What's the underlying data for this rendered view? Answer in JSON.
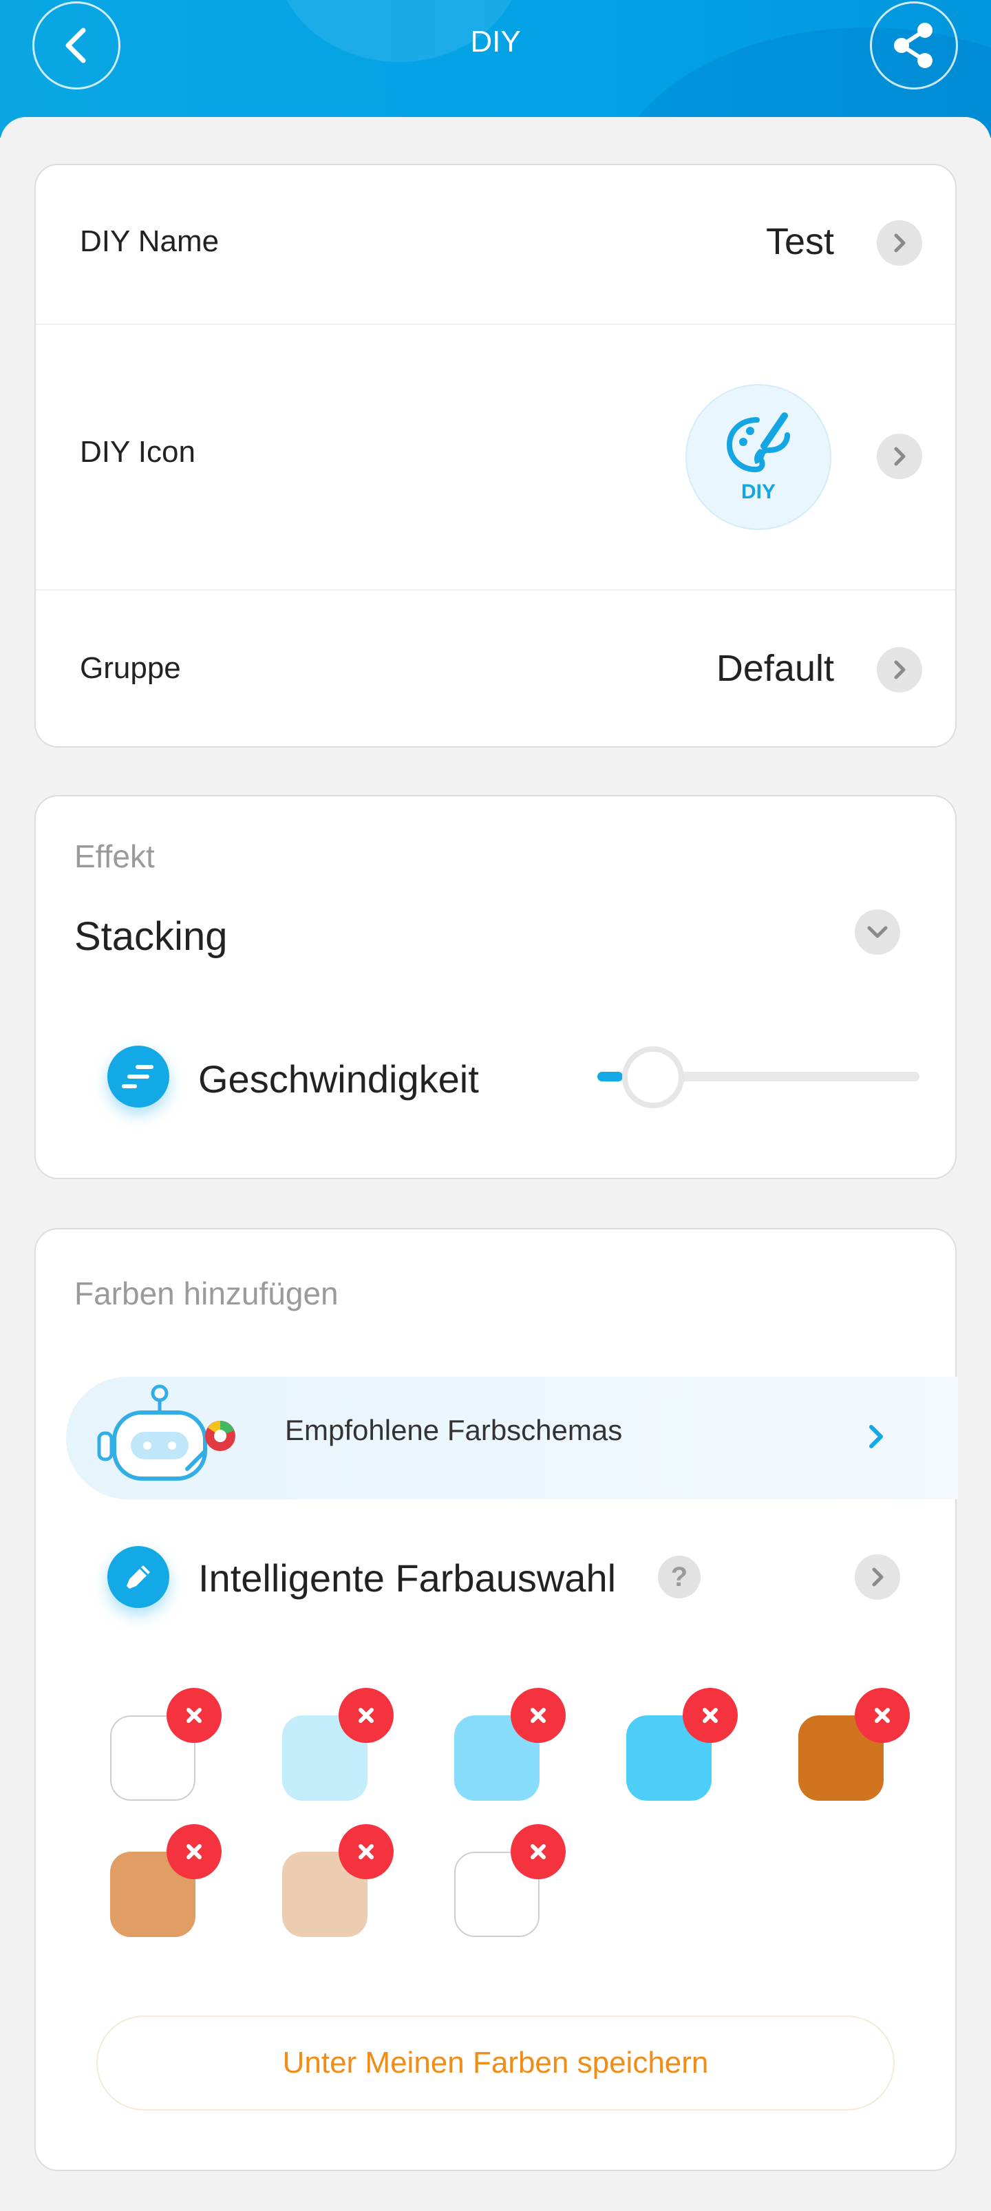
{
  "header": {
    "title": "DIY",
    "back_icon": "chevron-left-icon",
    "share_icon": "share-icon"
  },
  "details": {
    "name_label": "DIY Name",
    "name_value": "Test",
    "icon_label": "DIY Icon",
    "icon_text": "DIY",
    "group_label": "Gruppe",
    "group_value": "Default"
  },
  "effect": {
    "section_label": "Effekt",
    "value": "Stacking",
    "speed_label": "Geschwindigkeit",
    "speed_level": 0.08
  },
  "colors": {
    "section_label": "Farben hinzufügen",
    "recommended_label": "Empfohlene Farbschemas",
    "smart_pick_label": "Intelligente Farbauswahl",
    "help_glyph": "?",
    "swatches": [
      "#ffffff",
      "#c3edfb",
      "#88dcfb",
      "#4ccef7",
      "#d17420",
      "#e09e64",
      "#edcdb2",
      "#ffffff"
    ],
    "save_label": "Unter Meinen Farben speichern"
  },
  "accent_color": "#13a8e6",
  "remove_color": "#f5333f",
  "save_text_color": "#f18d17"
}
